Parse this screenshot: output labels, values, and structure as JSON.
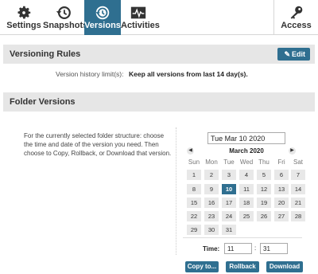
{
  "toolbar": {
    "items": [
      {
        "label": "Settings",
        "icon": "gear-icon"
      },
      {
        "label": "Snapshots",
        "icon": "history-icon"
      },
      {
        "label": "Versions",
        "icon": "versions-icon",
        "active": true
      },
      {
        "label": "Activities",
        "icon": "activity-icon"
      },
      {
        "label": "Access",
        "icon": "key-icon"
      }
    ]
  },
  "versioning_rules": {
    "title": "Versioning Rules",
    "edit_label": "Edit",
    "limit_label": "Version history limit(s):",
    "limit_value": "Keep all versions from last 14 day(s)."
  },
  "folder_versions": {
    "title": "Folder Versions",
    "description": "For the currently selected folder structure: choose the time and date of the version you need. Then choose to Copy, Rollback, or Download that version."
  },
  "calendar": {
    "date_value": "Tue Mar 10 2020",
    "month_label": "March  2020",
    "weekdays": [
      "Sun",
      "Mon",
      "Tue",
      "Wed",
      "Thu",
      "Fri",
      "Sat"
    ],
    "weeks": [
      [
        "1",
        "2",
        "3",
        "4",
        "5",
        "6",
        "7"
      ],
      [
        "8",
        "9",
        "10",
        "11",
        "12",
        "13",
        "14"
      ],
      [
        "15",
        "16",
        "17",
        "18",
        "19",
        "20",
        "21"
      ],
      [
        "22",
        "23",
        "24",
        "25",
        "26",
        "27",
        "28"
      ],
      [
        "29",
        "30",
        "31",
        "",
        "",
        "",
        ""
      ]
    ],
    "selected_day": "10",
    "time_label": "Time:",
    "hour": "11",
    "minute": "31"
  },
  "actions": {
    "copy": "Copy to...",
    "rollback": "Rollback",
    "download": "Download"
  },
  "colors": {
    "accent": "#2f6f90",
    "header_bg": "#e6e6e6"
  }
}
